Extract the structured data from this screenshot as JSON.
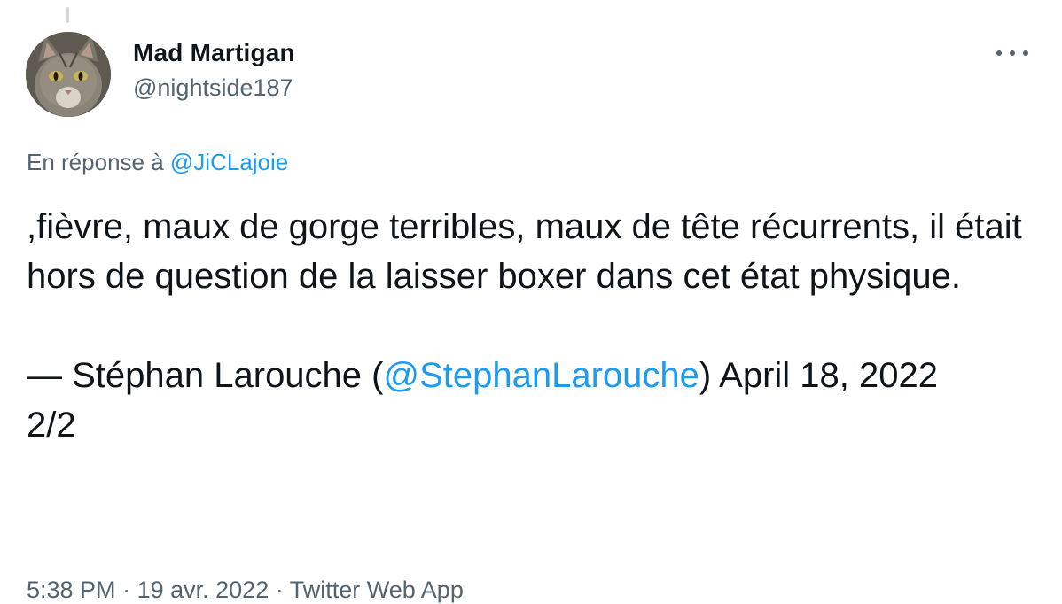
{
  "author": {
    "name": "Mad Martigan",
    "handle": "@nightside187"
  },
  "reply": {
    "prefix": "En réponse à",
    "mention": "@JiCLajoie"
  },
  "tweet": {
    "line1": ",fièvre, maux de gorge terribles, maux de tête récurrents, il était hors de question de la laisser boxer dans cet état physique.",
    "quote_prefix": "— Stéphan Larouche (",
    "quote_mention": "@StephanLarouche",
    "quote_suffix": ") April 18, 2022",
    "thread_count": "2/2"
  },
  "meta": {
    "time": "5:38 PM",
    "date": "19 avr. 2022",
    "source": "Twitter Web App",
    "separator": "·"
  },
  "colors": {
    "accent": "#1d9bf0",
    "text": "#0f1419",
    "secondary": "#536471"
  },
  "icons": {
    "more": "more-horizontal-icon"
  }
}
